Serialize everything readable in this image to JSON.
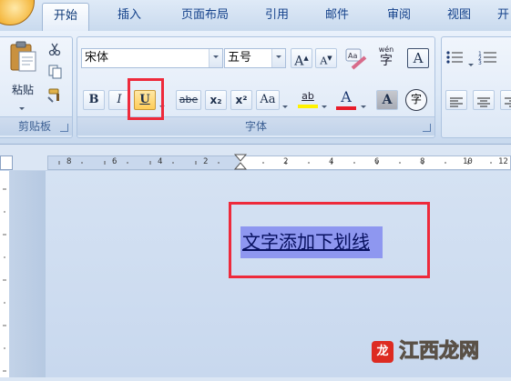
{
  "tabs": [
    {
      "label": "开始",
      "active": true
    },
    {
      "label": "插入",
      "active": false
    },
    {
      "label": "页面布局",
      "active": false
    },
    {
      "label": "引用",
      "active": false
    },
    {
      "label": "邮件",
      "active": false
    },
    {
      "label": "审阅",
      "active": false
    },
    {
      "label": "视图",
      "active": false
    },
    {
      "label": "开",
      "active": false
    }
  ],
  "clipboard": {
    "group_label": "剪贴板",
    "paste_label": "粘贴"
  },
  "font": {
    "group_label": "字体",
    "font_name": "宋体",
    "font_size": "五号",
    "grow_label": "A",
    "shrink_label": "A",
    "phonetic_label": "wén",
    "phonetic_char": "字",
    "border_label": "A",
    "bold_label": "B",
    "italic_label": "I",
    "underline_label": "U",
    "strike_label": "abe",
    "subscript_label": "x₂",
    "superscript_label": "x²",
    "case_label": "Aa",
    "highlight_label": "ab",
    "font_color_label": "A",
    "shading_label": "A",
    "enclose_label": "字"
  },
  "ruler": {
    "labels": [
      "8",
      "6",
      "4",
      "2",
      "2",
      "4",
      "6",
      "8",
      "10",
      "12"
    ]
  },
  "document": {
    "text": "文字添加下划线"
  },
  "watermark": {
    "text": "江西龙网",
    "logo": "龙"
  },
  "colors": {
    "accent": "#15428b",
    "highlight_annotation": "#ee2a3b",
    "selection": "#8e97f0",
    "font_color_bar": "#e81c2a",
    "highlight_bar": "#fff200"
  }
}
